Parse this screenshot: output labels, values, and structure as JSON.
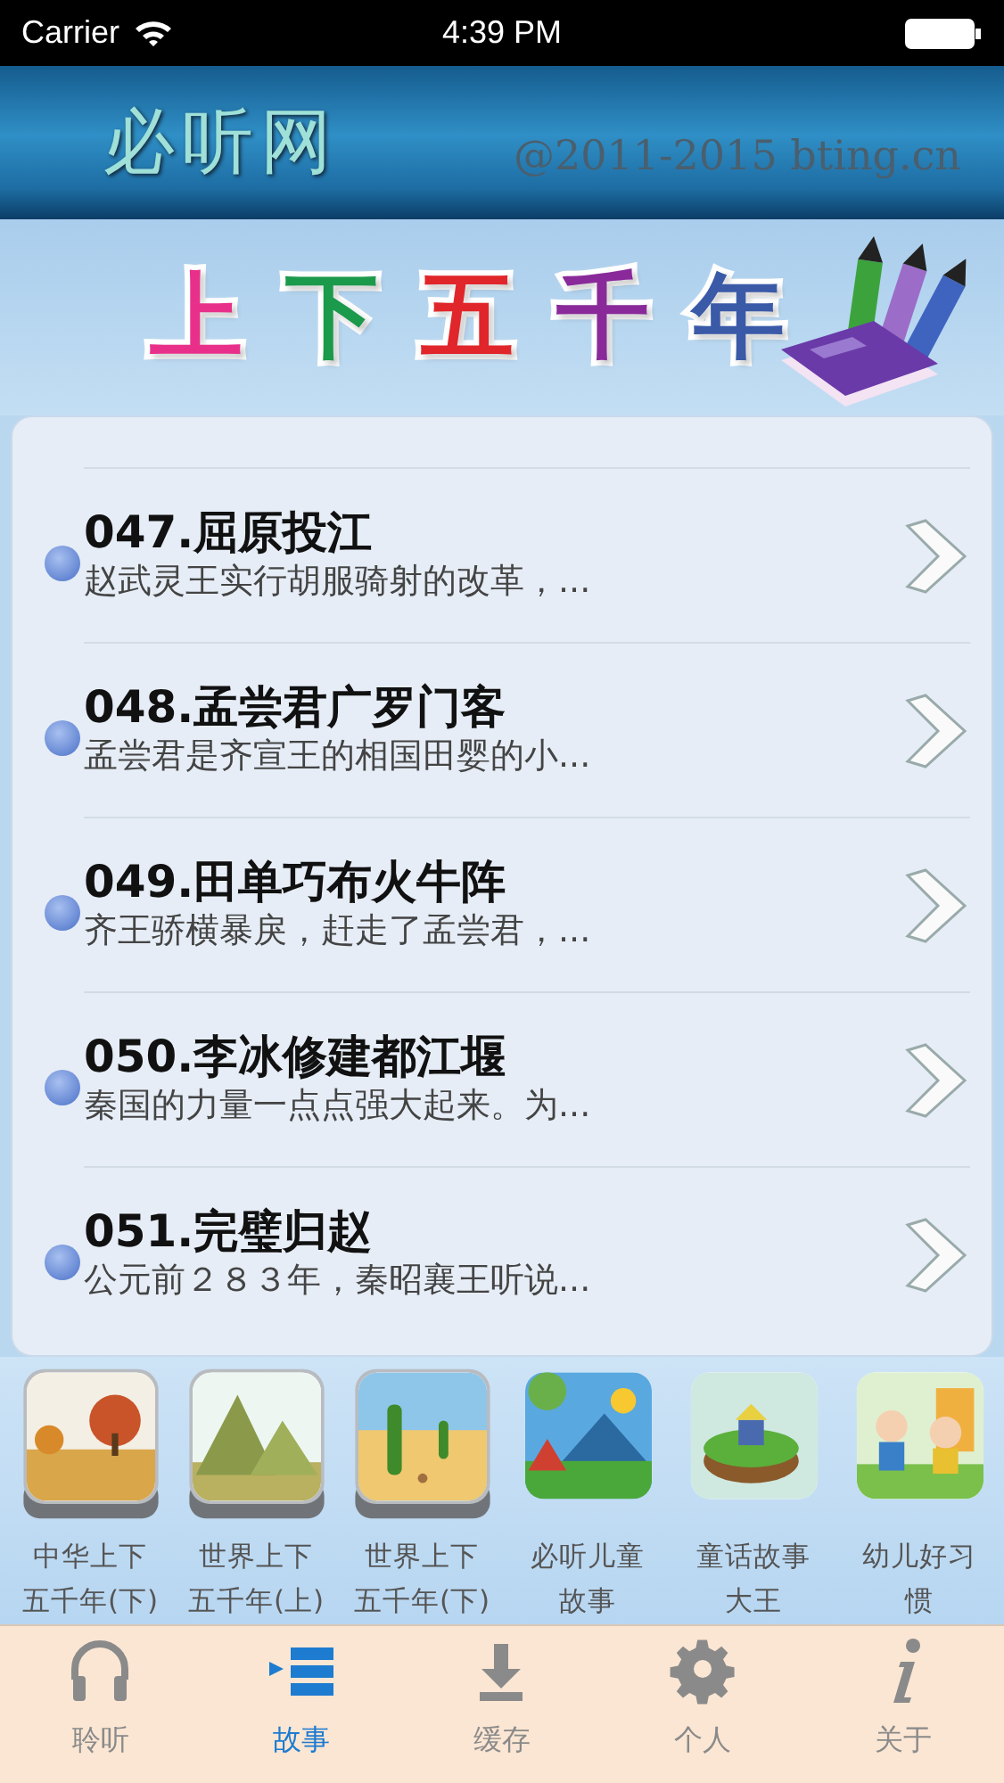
{
  "status_bar": {
    "carrier": "Carrier",
    "time": "4:39 PM"
  },
  "header": {
    "logo": "必听网",
    "copyright": "@2011-2015 bting.cn"
  },
  "banner": {
    "title": [
      {
        "char": "上",
        "color": "#e8308a"
      },
      {
        "char": "下",
        "color": "#1a9a4a"
      },
      {
        "char": "五",
        "color": "#e0262a"
      },
      {
        "char": "千",
        "color": "#8a2a9a"
      },
      {
        "char": "年",
        "color": "#3a5aa8"
      }
    ]
  },
  "stories": [
    {
      "title": "047.屈原投江",
      "summary": "赵武灵王实行胡服骑射的改革，..."
    },
    {
      "title": "048.孟尝君广罗门客",
      "summary": "孟尝君是齐宣王的相国田婴的小..."
    },
    {
      "title": "049.田单巧布火牛阵",
      "summary": "齐王骄横暴戾，赶走了孟尝君，..."
    },
    {
      "title": "050.李冰修建都江堰",
      "summary": "秦国的力量一点点强大起来。为..."
    },
    {
      "title": "051.完璧归赵",
      "summary": "公元前２８３年，秦昭襄王听说..."
    }
  ],
  "categories": [
    {
      "line1": "中华上下",
      "line2": "五千年(下)",
      "framed": true
    },
    {
      "line1": "世界上下",
      "line2": "五千年(上)",
      "framed": true
    },
    {
      "line1": "世界上下",
      "line2": "五千年(下)",
      "framed": true
    },
    {
      "line1": "必听儿童",
      "line2": "故事",
      "framed": false
    },
    {
      "line1": "童话故事",
      "line2": "大王",
      "framed": false
    },
    {
      "line1": "幼儿好习",
      "line2": "惯",
      "framed": false
    }
  ],
  "tabs": [
    {
      "label": "聆听",
      "selected": false
    },
    {
      "label": "故事",
      "selected": true
    },
    {
      "label": "缓存",
      "selected": false
    },
    {
      "label": "个人",
      "selected": false
    },
    {
      "label": "关于",
      "selected": false
    }
  ]
}
